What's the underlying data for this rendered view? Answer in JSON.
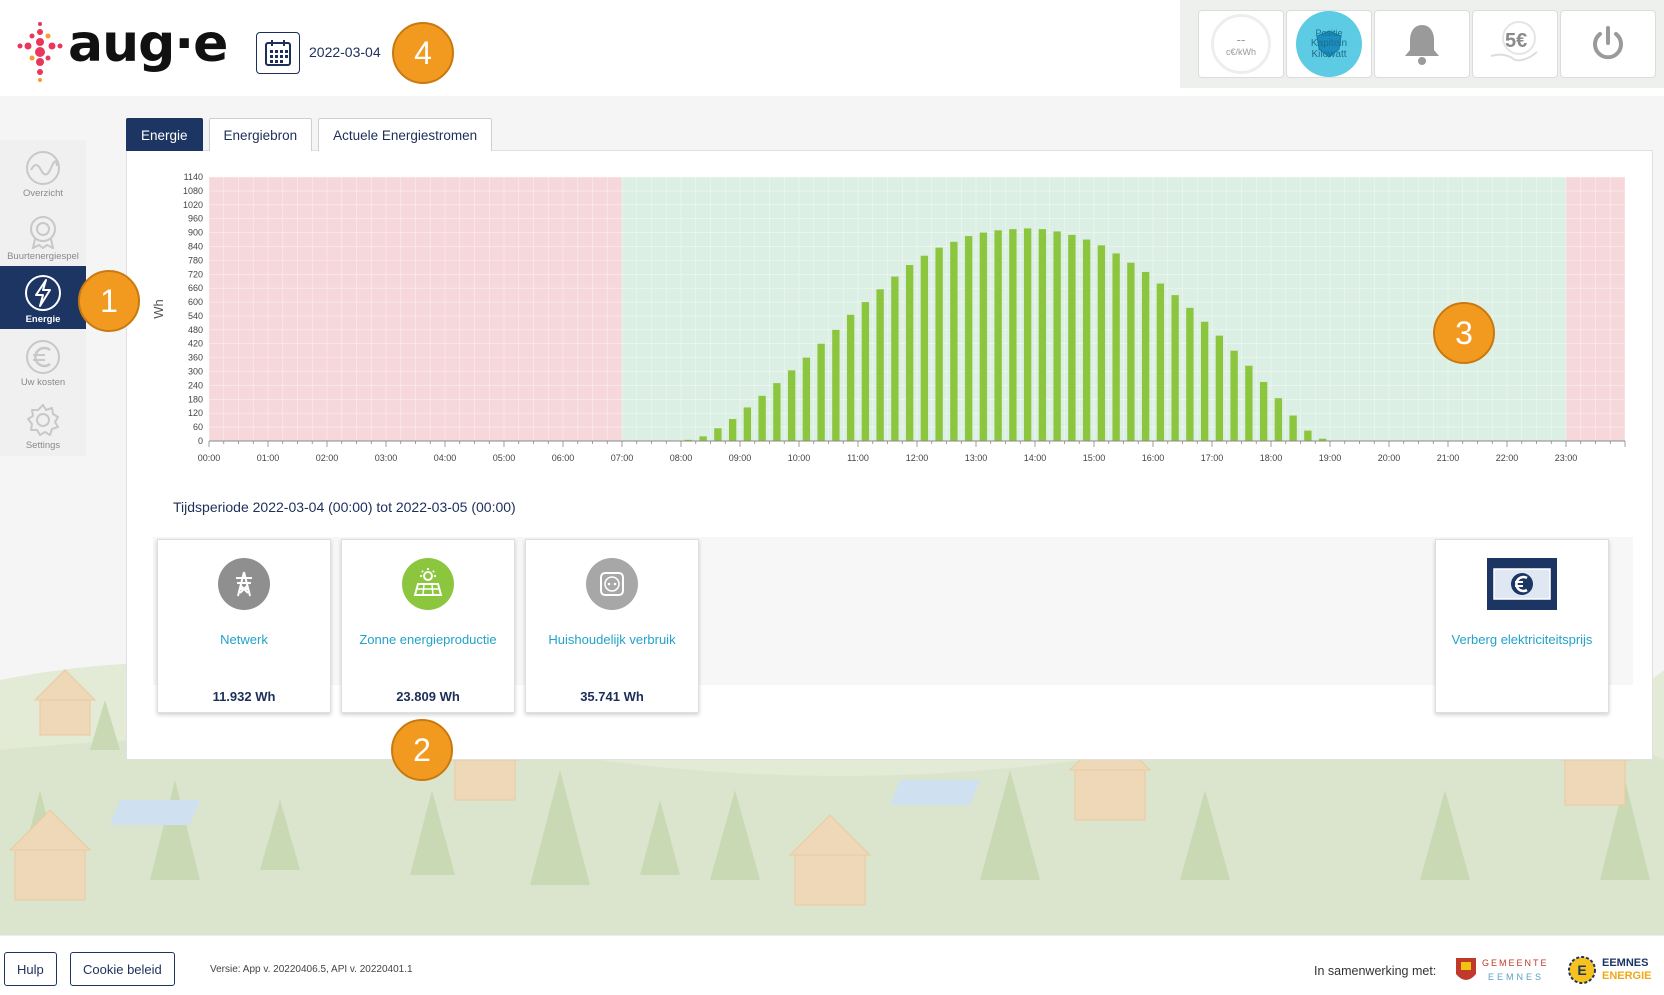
{
  "header": {
    "logo_text": "aug·e",
    "date": "2022-03-04",
    "price_value": "--",
    "price_unit": "c€/kWh",
    "badge_line1": "Positie",
    "badge_line2": "Kapitein",
    "badge_line3": "Kilowatt",
    "money_label": "5€"
  },
  "callouts": [
    "1",
    "2",
    "3",
    "4"
  ],
  "sidebar": {
    "items": [
      {
        "label": "Overzicht",
        "icon": "wave-icon"
      },
      {
        "label": "Buurtenergiespel",
        "icon": "award-icon"
      },
      {
        "label": "Energie",
        "icon": "lightning-icon"
      },
      {
        "label": "Uw kosten",
        "icon": "euro-icon"
      },
      {
        "label": "Settings",
        "icon": "gear-icon"
      }
    ]
  },
  "tabs": [
    "Energie",
    "Energiebron",
    "Actuele Energiestromen"
  ],
  "chart_data": {
    "type": "bar",
    "ylabel": "Wh",
    "ylim": [
      0,
      1140
    ],
    "yticks": [
      0,
      60,
      120,
      180,
      240,
      300,
      360,
      420,
      480,
      540,
      600,
      660,
      720,
      780,
      840,
      900,
      960,
      1020,
      1080,
      1140
    ],
    "xticks": [
      "00:00",
      "01:00",
      "02:00",
      "03:00",
      "04:00",
      "05:00",
      "06:00",
      "07:00",
      "08:00",
      "09:00",
      "10:00",
      "11:00",
      "12:00",
      "13:00",
      "14:00",
      "15:00",
      "16:00",
      "17:00",
      "18:00",
      "19:00",
      "20:00",
      "21:00",
      "22:00",
      "23:00"
    ],
    "interval_minutes": 15,
    "values": [
      0,
      0,
      0,
      0,
      0,
      0,
      0,
      0,
      0,
      0,
      0,
      0,
      0,
      0,
      0,
      0,
      0,
      0,
      0,
      0,
      0,
      0,
      0,
      0,
      0,
      0,
      0,
      0,
      0,
      0,
      0,
      0,
      5,
      20,
      55,
      95,
      145,
      195,
      250,
      305,
      360,
      420,
      480,
      545,
      600,
      655,
      710,
      760,
      800,
      835,
      860,
      885,
      900,
      910,
      915,
      918,
      915,
      905,
      890,
      870,
      845,
      810,
      770,
      730,
      680,
      630,
      575,
      515,
      455,
      390,
      325,
      255,
      185,
      110,
      45,
      10,
      0,
      0,
      0,
      0,
      0,
      0,
      0,
      0,
      0,
      0,
      0,
      0,
      0,
      0,
      0,
      0,
      0,
      0,
      0,
      0,
      0,
      0,
      0,
      0
    ],
    "shaded_regions": [
      {
        "from": "00:00",
        "to": "07:00",
        "color": "#f6d8da"
      },
      {
        "from": "07:00",
        "to": "23:00",
        "color": "#dcefe4"
      },
      {
        "from": "23:00",
        "to": "24:00",
        "color": "#f6d8da"
      }
    ],
    "bar_color": "#8cc63f"
  },
  "period": {
    "prefix": "Tijdsperiode",
    "range": "2022-03-04 (00:00) tot 2022-03-05 (00:00)"
  },
  "cards": [
    {
      "title": "Netwerk",
      "value": "11.932 Wh",
      "icon": "pylon-icon",
      "color": "#8f8f8f"
    },
    {
      "title": "Zonne energieproductie",
      "value": "23.809 Wh",
      "icon": "solar-panel-icon",
      "color": "#8cc63f"
    },
    {
      "title": "Huishoudelijk verbruik",
      "value": "35.741 Wh",
      "icon": "socket-icon",
      "color": "#a7a7a7"
    },
    {
      "title": "Verberg elektriciteitsprijs",
      "icon": "euro-banknote-icon"
    }
  ],
  "footer": {
    "help": "Hulp",
    "cookie": "Cookie beleid",
    "version": "Versie: App v. 20220406.5, API v. 20220401.1",
    "collab": "In samenwerking met:",
    "partner1_top": "GEMEENTE",
    "partner1_bottom": "EEMNES",
    "partner2_top": "EEMNES",
    "partner2_bottom": "ENERGIE"
  }
}
